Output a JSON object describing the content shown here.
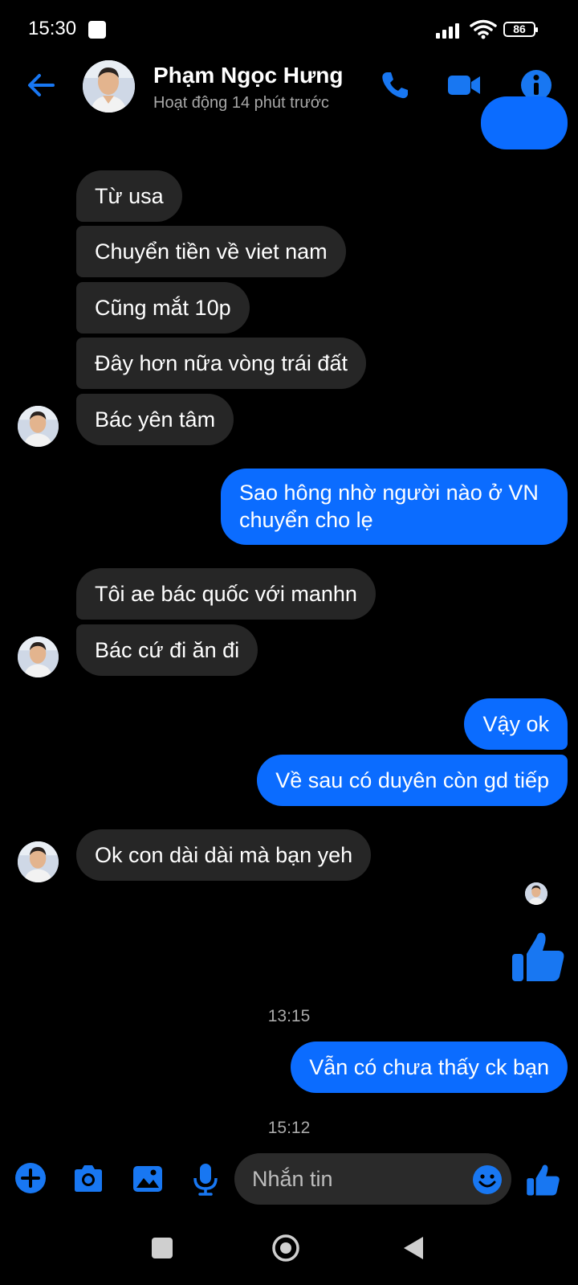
{
  "status_bar": {
    "time": "15:30",
    "battery": "86"
  },
  "header": {
    "name": "Phạm Ngọc Hưng",
    "status": "Hoạt động 14 phút trước",
    "icons": [
      "back-arrow-icon",
      "phone-icon",
      "video-camera-icon",
      "info-icon"
    ]
  },
  "messages": [
    {
      "sender": "them",
      "text": "Từ usa"
    },
    {
      "sender": "them",
      "text": "Chuyển tiền về viet nam"
    },
    {
      "sender": "them",
      "text": "Cũng mắt 10p"
    },
    {
      "sender": "them",
      "text": "Đây hơn nữa vòng trái đất"
    },
    {
      "sender": "them",
      "text": "Bác yên tâm"
    },
    {
      "sender": "me",
      "text": "Sao hông nhờ người nào ở VN chuyển cho lẹ"
    },
    {
      "sender": "them",
      "text": "Tôi ae bác quốc với manhn"
    },
    {
      "sender": "them",
      "text": "Bác cứ đi ăn đi"
    },
    {
      "sender": "me",
      "text": "Vậy ok"
    },
    {
      "sender": "me",
      "text": "Về sau có duyên còn gd tiếp"
    },
    {
      "sender": "them",
      "text": "Ok con dài dài mà bạn yeh"
    },
    {
      "sender": "me",
      "type": "like",
      "icon": "thumbs-up-icon"
    },
    {
      "sender": "me",
      "text": "Vẫn có chưa thấy ck bạn"
    }
  ],
  "timestamps": [
    "13:15",
    "15:12"
  ],
  "composer": {
    "placeholder": "Nhắn tin",
    "icons": [
      "plus-icon",
      "camera-icon",
      "image-icon",
      "microphone-icon",
      "emoji-icon",
      "thumbs-up-icon"
    ]
  },
  "colors": {
    "background": "#000000",
    "accent": "#0b6cff",
    "incoming_bubble": "#262626",
    "secondary_text": "#a8a8a8"
  }
}
